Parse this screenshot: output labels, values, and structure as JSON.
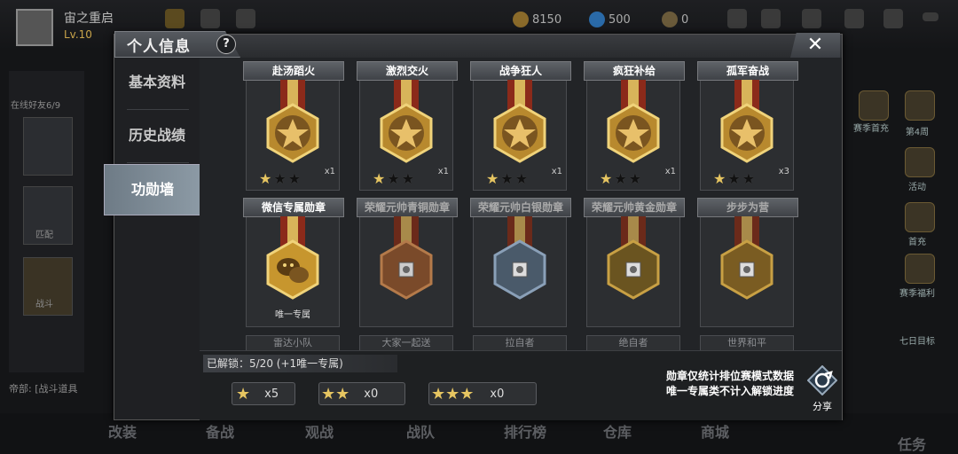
{
  "hud": {
    "player_name": "宙之重启",
    "player_level": "Lv.10",
    "gold": "8150",
    "diamond": "500",
    "ticket": "0",
    "online_friends": "在线好友6/9",
    "chat_preview": "帝部: [战斗道具"
  },
  "left_panel": {
    "match_label": "匹配",
    "battle_label": "战斗"
  },
  "right_panel": {
    "items": [
      "赛季首充",
      "第4周",
      "活动",
      "首充",
      "赛季福利",
      "七日目标"
    ]
  },
  "bottom_bar": {
    "items": [
      "改装",
      "备战",
      "观战",
      "战队",
      "排行榜",
      "仓库",
      "商城",
      "任务"
    ]
  },
  "dialog": {
    "title": "个人信息",
    "help_label": "?",
    "close_label": "✕",
    "nav": [
      {
        "label": "基本资料",
        "active": false
      },
      {
        "label": "历史战绩",
        "active": false
      },
      {
        "label": "功勋墙",
        "active": true
      }
    ],
    "medals_row1": [
      {
        "title": "赴汤蹈火",
        "stars": 1,
        "count": "x1"
      },
      {
        "title": "激烈交火",
        "stars": 1,
        "count": "x1"
      },
      {
        "title": "战争狂人",
        "stars": 1,
        "count": "x1"
      },
      {
        "title": "疯狂补给",
        "stars": 1,
        "count": "x1"
      },
      {
        "title": "孤军奋战",
        "stars": 1,
        "count": "x3"
      }
    ],
    "medals_row2": [
      {
        "title": "微信专属勋章",
        "kind": "wechat",
        "tag": "唯一专属"
      },
      {
        "title": "荣耀元帅青铜勋章",
        "kind": "bronze"
      },
      {
        "title": "荣耀元帅白银勋章",
        "kind": "silver"
      },
      {
        "title": "荣耀元帅黄金勋章",
        "kind": "gold"
      },
      {
        "title": "步步为营",
        "kind": "gold"
      }
    ],
    "medals_row3_labels": [
      "雷达小队",
      "大家一起送",
      "拉自者",
      "绝自者",
      "世界和平"
    ],
    "unlock_text": "已解锁：5/20  (+1唯一专属)",
    "tiers": [
      {
        "stars": "★",
        "count": "x5"
      },
      {
        "stars": "★★",
        "count": "x0"
      },
      {
        "stars": "★★★",
        "count": "x0"
      }
    ],
    "note_line1": "勋章仅统计排位赛模式数据",
    "note_line2": "唯一专属类不计入解锁进度",
    "share_label": "分享"
  },
  "colors": {
    "gold": "#e6c561",
    "active_tab": "#8c9aa5"
  }
}
